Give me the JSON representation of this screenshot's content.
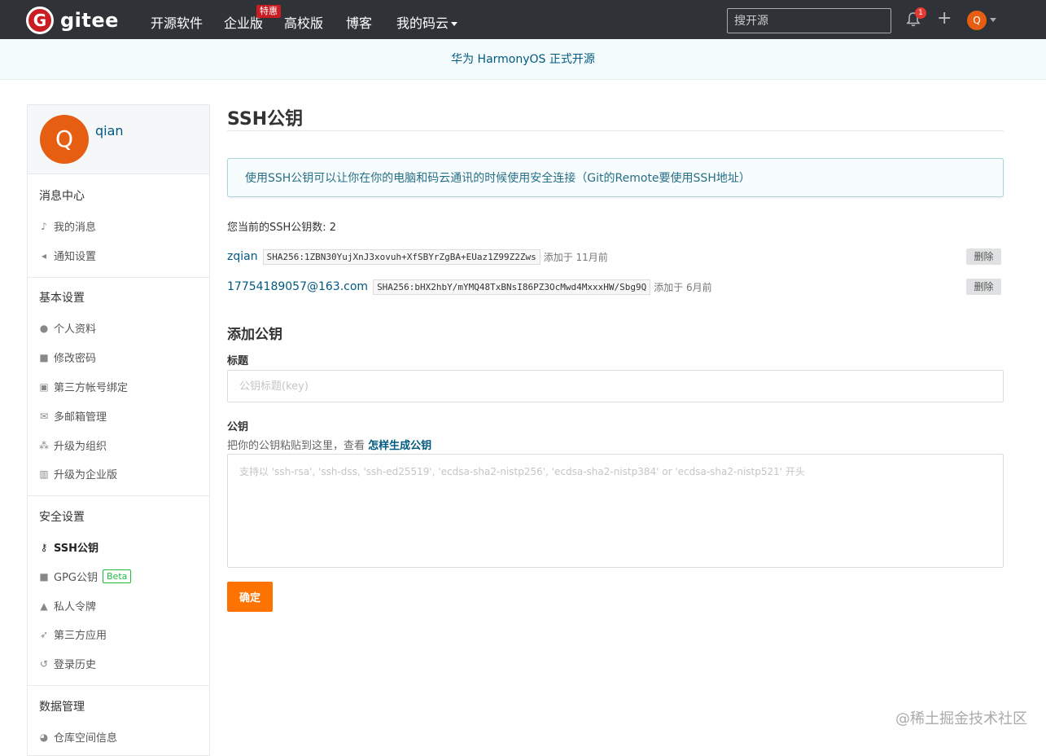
{
  "nav": {
    "logo_text": "gitee",
    "logo_mark": "G",
    "items": [
      "开源软件",
      "企业版",
      "高校版",
      "博客",
      "我的码云"
    ],
    "badge": "特惠",
    "search_placeholder": "搜开源",
    "notification_count": "1",
    "avatar_letter": "Q"
  },
  "banner": {
    "text": "华为 HarmonyOS 正式开源"
  },
  "sidebar": {
    "user": {
      "avatar_letter": "Q",
      "name": "qian"
    },
    "sections": [
      {
        "title": "消息中心",
        "items": [
          {
            "label": "我的消息",
            "icon": "bell-icon"
          },
          {
            "label": "通知设置",
            "icon": "volume-icon"
          }
        ]
      },
      {
        "title": "基本设置",
        "items": [
          {
            "label": "个人资料",
            "icon": "user-icon"
          },
          {
            "label": "修改密码",
            "icon": "unlock-icon"
          },
          {
            "label": "第三方帐号绑定",
            "icon": "id-card-icon"
          },
          {
            "label": "多邮箱管理",
            "icon": "mail-icon"
          },
          {
            "label": "升级为组织",
            "icon": "users-icon"
          },
          {
            "label": "升级为企业版",
            "icon": "building-icon"
          }
        ]
      },
      {
        "title": "安全设置",
        "items": [
          {
            "label": "SSH公钥",
            "icon": "key-icon"
          },
          {
            "label": "GPG公钥",
            "icon": "lock-icon",
            "badge": "Beta"
          },
          {
            "label": "私人令牌",
            "icon": "spy-icon"
          },
          {
            "label": "第三方应用",
            "icon": "rocket-icon"
          },
          {
            "label": "登录历史",
            "icon": "history-icon"
          }
        ]
      },
      {
        "title": "数据管理",
        "items": [
          {
            "label": "仓库空间信息",
            "icon": "pie-chart-icon"
          }
        ]
      }
    ]
  },
  "main": {
    "title": "SSH公钥",
    "info": "使用SSH公钥可以让你在你的电脑和码云通讯的时候使用安全连接（Git的Remote要使用SSH地址）",
    "key_count": "您当前的SSH公钥数: 2",
    "keys": [
      {
        "name": "zqian",
        "fingerprint": "SHA256:1ZBN30YujXnJ3xovuh+XfSBYrZgBA+EUaz1Z99Z2Zws",
        "added": "添加于 11月前",
        "delete_label": "删除"
      },
      {
        "name": "17754189057@163.com",
        "fingerprint": "SHA256:bHX2hbY/mYMQ48TxBNsI86PZ3OcMwd4MxxxHW/Sbg9Q",
        "added": "添加于 6月前",
        "delete_label": "删除"
      }
    ],
    "add_title": "添加公钥",
    "title_label": "标题",
    "title_placeholder": "公钥标题(key)",
    "key_label": "公钥",
    "hint_text": "把你的公钥粘贴到这里，查看",
    "hint_link": "怎样生成公钥",
    "key_placeholder": "支持以 'ssh-rsa', 'ssh-dss, 'ssh-ed25519', 'ecdsa-sha2-nistp256', 'ecdsa-sha2-nistp384' or 'ecdsa-sha2-nistp521' 开头",
    "submit_label": "确定"
  },
  "watermark": "@稀土掘金技术社区"
}
